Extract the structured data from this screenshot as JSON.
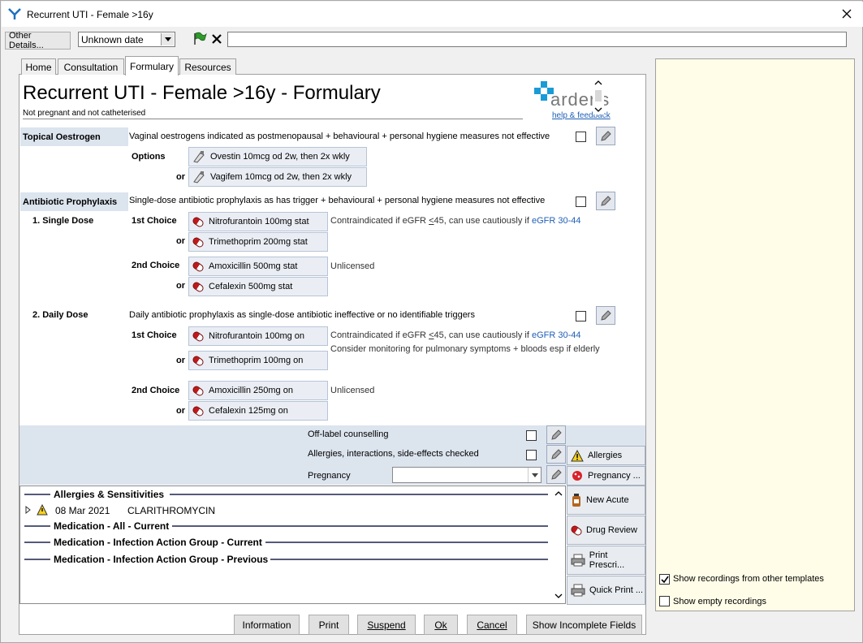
{
  "window": {
    "title": "Recurrent UTI - Female >16y"
  },
  "toolbar": {
    "other_details": "Other Details...",
    "date_value": "Unknown date",
    "text_value": ""
  },
  "tabs": [
    "Home",
    "Consultation",
    "Formulary",
    "Resources"
  ],
  "page": {
    "title": "Recurrent UTI - Female >16y - Formulary",
    "subtitle": "Not pregnant and not catheterised",
    "logo_text": "ardens",
    "help_link": "help & feedback"
  },
  "topical": {
    "heading": "Topical Oestrogen",
    "desc": "Vaginal oestrogens indicated as postmenopausal + behavioural + personal hygiene measures not effective",
    "options_label": "Options",
    "or_label": "or",
    "drug1": "Ovestin 10mcg od 2w, then 2x wkly",
    "drug2": "Vagifem 10mcg od 2w, then 2x wkly"
  },
  "prophylaxis": {
    "heading": "Antibiotic Prophylaxis",
    "desc": "Single-dose antibiotic prophylaxis as has trigger + behavioural + personal hygiene measures not effective"
  },
  "single": {
    "heading": "1. Single Dose",
    "first_choice": "1st Choice",
    "second_choice": "2nd Choice",
    "or_label": "or",
    "drug1": "Nitrofurantoin 100mg stat",
    "drug2": "Trimethoprim 200mg stat",
    "drug3": "Amoxicillin 500mg stat",
    "drug4": "Cefalexin 500mg stat",
    "note1_prefix": "Contraindicated if eGFR ",
    "note1_lt": "<",
    "note1_mid": "45, can use cautiously if ",
    "note1_link": "eGFR 30-44",
    "note2": "Unlicensed"
  },
  "daily": {
    "heading": "2. Daily Dose",
    "desc": "Daily antibiotic prophylaxis as single-dose antibiotic ineffective or no identifiable triggers",
    "first_choice": "1st Choice",
    "second_choice": "2nd Choice",
    "or_label": "or",
    "drug1": "Nitrofurantoin 100mg on",
    "drug2": "Trimethoprim 100mg on",
    "drug3": "Amoxicillin 250mg on",
    "drug4": "Cefalexin 125mg on",
    "note1_prefix": "Contraindicated if eGFR ",
    "note1_lt": "<",
    "note1_mid": "45, can use cautiously if ",
    "note1_link": "eGFR 30-44",
    "note1b": "Consider monitoring for pulmonary symptoms + bloods esp if elderly",
    "note2": "Unlicensed"
  },
  "checks": {
    "offlabel": "Off-label counselling",
    "allergies_checked": "Allergies, interactions, side-effects checked",
    "pregnancy": "Pregnancy",
    "pregnancy_value": ""
  },
  "side_buttons": {
    "allergies": "Allergies",
    "pregnancy": "Pregnancy ...",
    "new_acute": "New Acute",
    "drug_review": "Drug Review",
    "print_prescri": "Print Prescri...",
    "quick_print": "Quick Print ..."
  },
  "record": {
    "sections": [
      "Allergies & Sensitivities",
      "Medication - All - Current",
      "Medication - Infection Action Group - Current",
      "Medication - Infection Action Group - Previous"
    ],
    "allergy_date": "08 Mar 2021",
    "allergy_name": "CLARITHROMYCIN"
  },
  "right_panel": {
    "show_recordings": "Show recordings from other templates",
    "show_recordings_checked": true,
    "show_empty": "Show empty recordings",
    "show_empty_checked": false
  },
  "footer": {
    "information": "Information",
    "print": "Print",
    "suspend": "Suspend",
    "ok": "Ok",
    "cancel": "Cancel",
    "show_incomplete": "Show Incomplete Fields"
  }
}
